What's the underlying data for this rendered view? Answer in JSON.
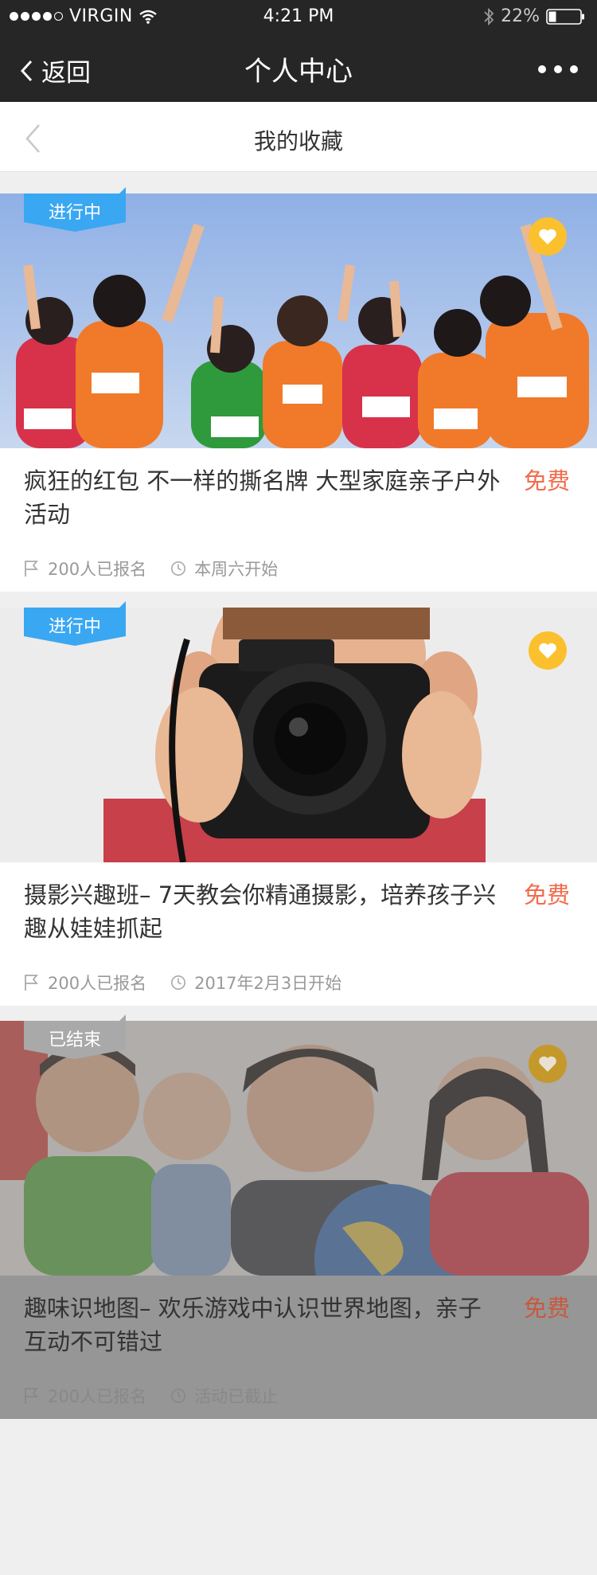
{
  "status_bar": {
    "carrier": "VIRGIN",
    "time": "4:21 PM",
    "battery": "22%",
    "signal_dots": 5,
    "signal_filled": 4
  },
  "nav": {
    "back_label": "返回",
    "title": "个人中心"
  },
  "sub_header": {
    "title": "我的收藏"
  },
  "colors": {
    "accent_blue": "#3aa7f2",
    "price_orange": "#f26b4b",
    "favorite_yellow": "#fbc02d",
    "ended_grey": "#a9a9a9"
  },
  "cards": [
    {
      "status": "进行中",
      "title": "疯狂的红包 不一样的撕名牌 大型家庭亲子户外活动",
      "price": "免费",
      "signups": "200人已报名",
      "time": "本周六开始",
      "ended": false
    },
    {
      "status": "进行中",
      "title": "摄影兴趣班– 7天教会你精通摄影，培养孩子兴趣从娃娃抓起",
      "price": "免费",
      "signups": "200人已报名",
      "time": "2017年2月3日开始",
      "ended": false
    },
    {
      "status": "已结束",
      "title": "趣味识地图– 欢乐游戏中认识世界地图，亲子互动不可错过",
      "price": "免费",
      "signups": "200人已报名",
      "time": "活动已截止",
      "ended": true
    }
  ]
}
